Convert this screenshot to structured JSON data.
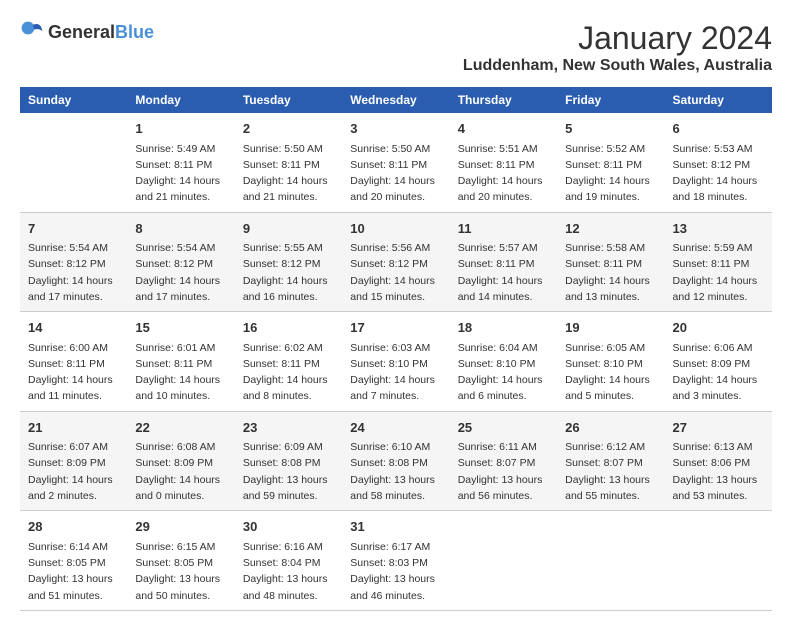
{
  "header": {
    "logo_general": "General",
    "logo_blue": "Blue",
    "title": "January 2024",
    "subtitle": "Luddenham, New South Wales, Australia"
  },
  "days_of_week": [
    "Sunday",
    "Monday",
    "Tuesday",
    "Wednesday",
    "Thursday",
    "Friday",
    "Saturday"
  ],
  "rows": [
    [
      {
        "day": "",
        "content": ""
      },
      {
        "day": "1",
        "content": "Sunrise: 5:49 AM\nSunset: 8:11 PM\nDaylight: 14 hours\nand 21 minutes."
      },
      {
        "day": "2",
        "content": "Sunrise: 5:50 AM\nSunset: 8:11 PM\nDaylight: 14 hours\nand 21 minutes."
      },
      {
        "day": "3",
        "content": "Sunrise: 5:50 AM\nSunset: 8:11 PM\nDaylight: 14 hours\nand 20 minutes."
      },
      {
        "day": "4",
        "content": "Sunrise: 5:51 AM\nSunset: 8:11 PM\nDaylight: 14 hours\nand 20 minutes."
      },
      {
        "day": "5",
        "content": "Sunrise: 5:52 AM\nSunset: 8:11 PM\nDaylight: 14 hours\nand 19 minutes."
      },
      {
        "day": "6",
        "content": "Sunrise: 5:53 AM\nSunset: 8:12 PM\nDaylight: 14 hours\nand 18 minutes."
      }
    ],
    [
      {
        "day": "7",
        "content": "Sunrise: 5:54 AM\nSunset: 8:12 PM\nDaylight: 14 hours\nand 17 minutes."
      },
      {
        "day": "8",
        "content": "Sunrise: 5:54 AM\nSunset: 8:12 PM\nDaylight: 14 hours\nand 17 minutes."
      },
      {
        "day": "9",
        "content": "Sunrise: 5:55 AM\nSunset: 8:12 PM\nDaylight: 14 hours\nand 16 minutes."
      },
      {
        "day": "10",
        "content": "Sunrise: 5:56 AM\nSunset: 8:12 PM\nDaylight: 14 hours\nand 15 minutes."
      },
      {
        "day": "11",
        "content": "Sunrise: 5:57 AM\nSunset: 8:11 PM\nDaylight: 14 hours\nand 14 minutes."
      },
      {
        "day": "12",
        "content": "Sunrise: 5:58 AM\nSunset: 8:11 PM\nDaylight: 14 hours\nand 13 minutes."
      },
      {
        "day": "13",
        "content": "Sunrise: 5:59 AM\nSunset: 8:11 PM\nDaylight: 14 hours\nand 12 minutes."
      }
    ],
    [
      {
        "day": "14",
        "content": "Sunrise: 6:00 AM\nSunset: 8:11 PM\nDaylight: 14 hours\nand 11 minutes."
      },
      {
        "day": "15",
        "content": "Sunrise: 6:01 AM\nSunset: 8:11 PM\nDaylight: 14 hours\nand 10 minutes."
      },
      {
        "day": "16",
        "content": "Sunrise: 6:02 AM\nSunset: 8:11 PM\nDaylight: 14 hours\nand 8 minutes."
      },
      {
        "day": "17",
        "content": "Sunrise: 6:03 AM\nSunset: 8:10 PM\nDaylight: 14 hours\nand 7 minutes."
      },
      {
        "day": "18",
        "content": "Sunrise: 6:04 AM\nSunset: 8:10 PM\nDaylight: 14 hours\nand 6 minutes."
      },
      {
        "day": "19",
        "content": "Sunrise: 6:05 AM\nSunset: 8:10 PM\nDaylight: 14 hours\nand 5 minutes."
      },
      {
        "day": "20",
        "content": "Sunrise: 6:06 AM\nSunset: 8:09 PM\nDaylight: 14 hours\nand 3 minutes."
      }
    ],
    [
      {
        "day": "21",
        "content": "Sunrise: 6:07 AM\nSunset: 8:09 PM\nDaylight: 14 hours\nand 2 minutes."
      },
      {
        "day": "22",
        "content": "Sunrise: 6:08 AM\nSunset: 8:09 PM\nDaylight: 14 hours\nand 0 minutes."
      },
      {
        "day": "23",
        "content": "Sunrise: 6:09 AM\nSunset: 8:08 PM\nDaylight: 13 hours\nand 59 minutes."
      },
      {
        "day": "24",
        "content": "Sunrise: 6:10 AM\nSunset: 8:08 PM\nDaylight: 13 hours\nand 58 minutes."
      },
      {
        "day": "25",
        "content": "Sunrise: 6:11 AM\nSunset: 8:07 PM\nDaylight: 13 hours\nand 56 minutes."
      },
      {
        "day": "26",
        "content": "Sunrise: 6:12 AM\nSunset: 8:07 PM\nDaylight: 13 hours\nand 55 minutes."
      },
      {
        "day": "27",
        "content": "Sunrise: 6:13 AM\nSunset: 8:06 PM\nDaylight: 13 hours\nand 53 minutes."
      }
    ],
    [
      {
        "day": "28",
        "content": "Sunrise: 6:14 AM\nSunset: 8:05 PM\nDaylight: 13 hours\nand 51 minutes."
      },
      {
        "day": "29",
        "content": "Sunrise: 6:15 AM\nSunset: 8:05 PM\nDaylight: 13 hours\nand 50 minutes."
      },
      {
        "day": "30",
        "content": "Sunrise: 6:16 AM\nSunset: 8:04 PM\nDaylight: 13 hours\nand 48 minutes."
      },
      {
        "day": "31",
        "content": "Sunrise: 6:17 AM\nSunset: 8:03 PM\nDaylight: 13 hours\nand 46 minutes."
      },
      {
        "day": "",
        "content": ""
      },
      {
        "day": "",
        "content": ""
      },
      {
        "day": "",
        "content": ""
      }
    ]
  ]
}
